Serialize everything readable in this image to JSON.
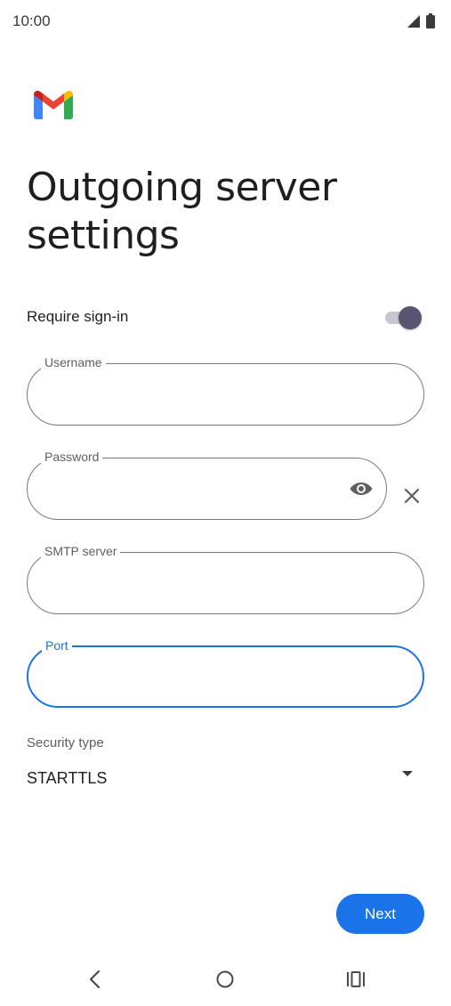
{
  "status_bar": {
    "time": "10:00",
    "icons": [
      "signal-icon",
      "battery-icon"
    ]
  },
  "header": {
    "logo": "gmail-logo",
    "title": "Outgoing server settings"
  },
  "form": {
    "require_sign_in": {
      "label": "Require sign-in",
      "enabled": true
    },
    "username": {
      "label": "Username",
      "value": ""
    },
    "password": {
      "label": "Password",
      "value": "",
      "visibility_icon": "eye-icon",
      "clear_icon": "close-icon"
    },
    "smtp_server": {
      "label": "SMTP server",
      "value": ""
    },
    "port": {
      "label": "Port",
      "value": "",
      "focused": true
    },
    "security_type": {
      "label": "Security type",
      "value": "STARTTLS",
      "icon": "dropdown-arrow-icon"
    }
  },
  "actions": {
    "next_label": "Next"
  },
  "nav_bar": {
    "icons": [
      "back-icon",
      "home-icon",
      "recents-icon"
    ]
  },
  "colors": {
    "accent": "#1a73e8",
    "toggle_thumb": "#5b5470",
    "toggle_track": "#c9c6cf",
    "outline": "#7a7a7a"
  }
}
